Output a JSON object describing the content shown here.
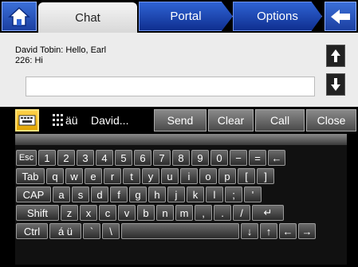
{
  "tabs": {
    "chat": "Chat",
    "portal": "Portal",
    "options": "Options"
  },
  "chat": {
    "messages": [
      "David Tobin: Hello, Earl",
      "226: Hi"
    ],
    "input_value": ""
  },
  "commands": {
    "lang_label": "äü",
    "recipient": "David...",
    "send": "Send",
    "clear": "Clear",
    "call": "Call",
    "close": "Close"
  },
  "keyboard": {
    "row1": [
      "Esc",
      "1",
      "2",
      "3",
      "4",
      "5",
      "6",
      "7",
      "8",
      "9",
      "0",
      "−",
      "=",
      "←"
    ],
    "row2": [
      "Tab",
      "q",
      "w",
      "e",
      "r",
      "t",
      "y",
      "u",
      "i",
      "o",
      "p",
      "[",
      "]"
    ],
    "row3": [
      "CAP",
      "a",
      "s",
      "d",
      "f",
      "g",
      "h",
      "j",
      "k",
      "l",
      ";",
      "'"
    ],
    "row4": [
      "Shift",
      "z",
      "x",
      "c",
      "v",
      "b",
      "n",
      "m",
      ",",
      ".",
      "/",
      "↵"
    ],
    "row5": [
      "Ctrl",
      "á ü",
      "`",
      "\\",
      "",
      "↓",
      "↑",
      "←",
      "→"
    ]
  },
  "colors": {
    "tab_blue": "#2f63d4",
    "keyboard_toggle": "#f2b800",
    "key_dark": "#2c2c2c"
  }
}
